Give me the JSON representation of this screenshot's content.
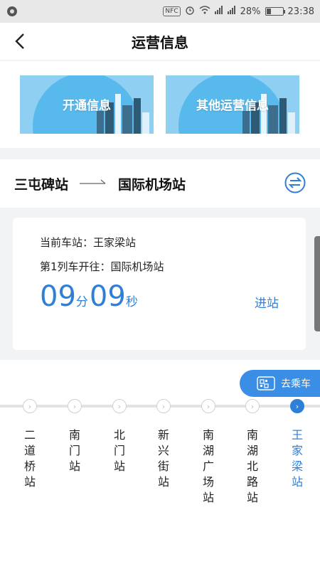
{
  "status_bar": {
    "nfc": "NFC",
    "battery": "28%",
    "battery_level": 0.28,
    "time": "23:38"
  },
  "header": {
    "title": "运营信息",
    "back_icon": "chevron-left-icon"
  },
  "banners": [
    {
      "label": "开通信息"
    },
    {
      "label": "其他运营信息"
    }
  ],
  "route": {
    "from": "三屯碑站",
    "to": "国际机场站",
    "swap_icon": "swap-icon"
  },
  "card": {
    "current_station": "当前车站：王家梁站",
    "first_train": "第1列车开往：国际机场站",
    "minutes": "09",
    "minutes_unit": "分",
    "seconds": "09",
    "seconds_unit": "秒",
    "enter_label": "进站"
  },
  "go_ride": {
    "label": "去乘车",
    "icon": "qr-code-icon"
  },
  "stations": [
    {
      "name": "二道桥站",
      "active": false
    },
    {
      "name": "南门站",
      "active": false
    },
    {
      "name": "北门站",
      "active": false
    },
    {
      "name": "新兴街站",
      "active": false
    },
    {
      "name": "南湖广场站",
      "active": false
    },
    {
      "name": "南湖北路站",
      "active": false
    },
    {
      "name": "王家梁站",
      "active": true
    }
  ],
  "colors": {
    "accent": "#2e7fd8",
    "button": "#3a8ee6",
    "banner": "#8fd0f2"
  }
}
